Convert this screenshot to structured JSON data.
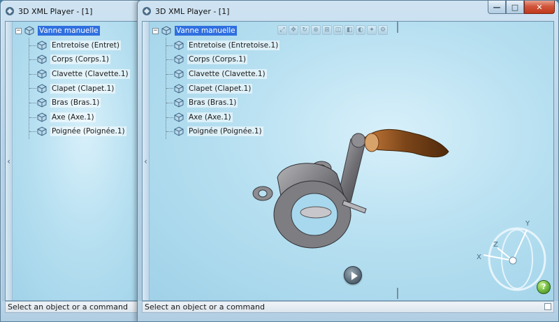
{
  "back_window": {
    "title": "3D XML Player - [1]",
    "tree": {
      "root": "Vanne manuelle",
      "items": [
        "Entretoise (Entret)",
        "Corps (Corps.1)",
        "Clavette (Clavette.1)",
        "Clapet (Clapet.1)",
        "Bras (Bras.1)",
        "Axe (Axe.1)",
        "Poignée (Poignée.1)"
      ]
    },
    "status": "Select an object or a command"
  },
  "front_window": {
    "title": "3D XML Player - [1]",
    "caption_buttons": {
      "minimize": "—",
      "maximize": "□",
      "close": "✕"
    },
    "tree": {
      "root": "Vanne manuelle",
      "items": [
        "Entretoise (Entretoise.1)",
        "Corps (Corps.1)",
        "Clavette (Clavette.1)",
        "Clapet (Clapet.1)",
        "Bras (Bras.1)",
        "Axe (Axe.1)",
        "Poignée (Poignée.1)"
      ]
    },
    "toolbar_icons": [
      "fit-all-icon",
      "pan-icon",
      "rotate-icon",
      "zoom-icon",
      "zoom-area-icon",
      "normal-view-icon",
      "view-mode-icon",
      "hide-show-icon",
      "camera-icon",
      "settings-icon"
    ],
    "compass_axes": {
      "x": "X",
      "y": "Y",
      "z": "Z"
    },
    "status": "Select an object or a command"
  },
  "colors": {
    "selection": "#2f6fe0",
    "viewport_bg": "#b7e0f1",
    "close_button": "#c0391c"
  }
}
